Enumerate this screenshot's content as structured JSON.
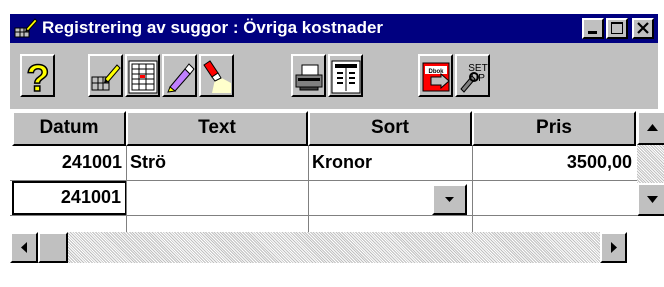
{
  "window": {
    "title": "Registrering av suggor : Övriga kostnader",
    "titlebar_color": "#000080"
  },
  "toolbar": {
    "buttons": [
      {
        "icon": "help-icon"
      },
      {
        "icon": "edit-record-icon"
      },
      {
        "icon": "form-grid-icon"
      },
      {
        "icon": "marker-pen-icon"
      },
      {
        "icon": "flashlight-search-icon"
      },
      {
        "icon": "printer-icon"
      },
      {
        "icon": "report-icon"
      },
      {
        "icon": "exit-icon",
        "label": "Dbok"
      },
      {
        "icon": "setup-icon",
        "label": "SET UP"
      }
    ]
  },
  "grid": {
    "columns": [
      "Datum",
      "Text",
      "Sort",
      "Pris"
    ],
    "rows": [
      {
        "datum": "241001",
        "text": "Strö",
        "sort": "Kronor",
        "pris": "3500,00"
      },
      {
        "datum": "241001",
        "text": "",
        "sort": "",
        "pris": ""
      }
    ]
  }
}
